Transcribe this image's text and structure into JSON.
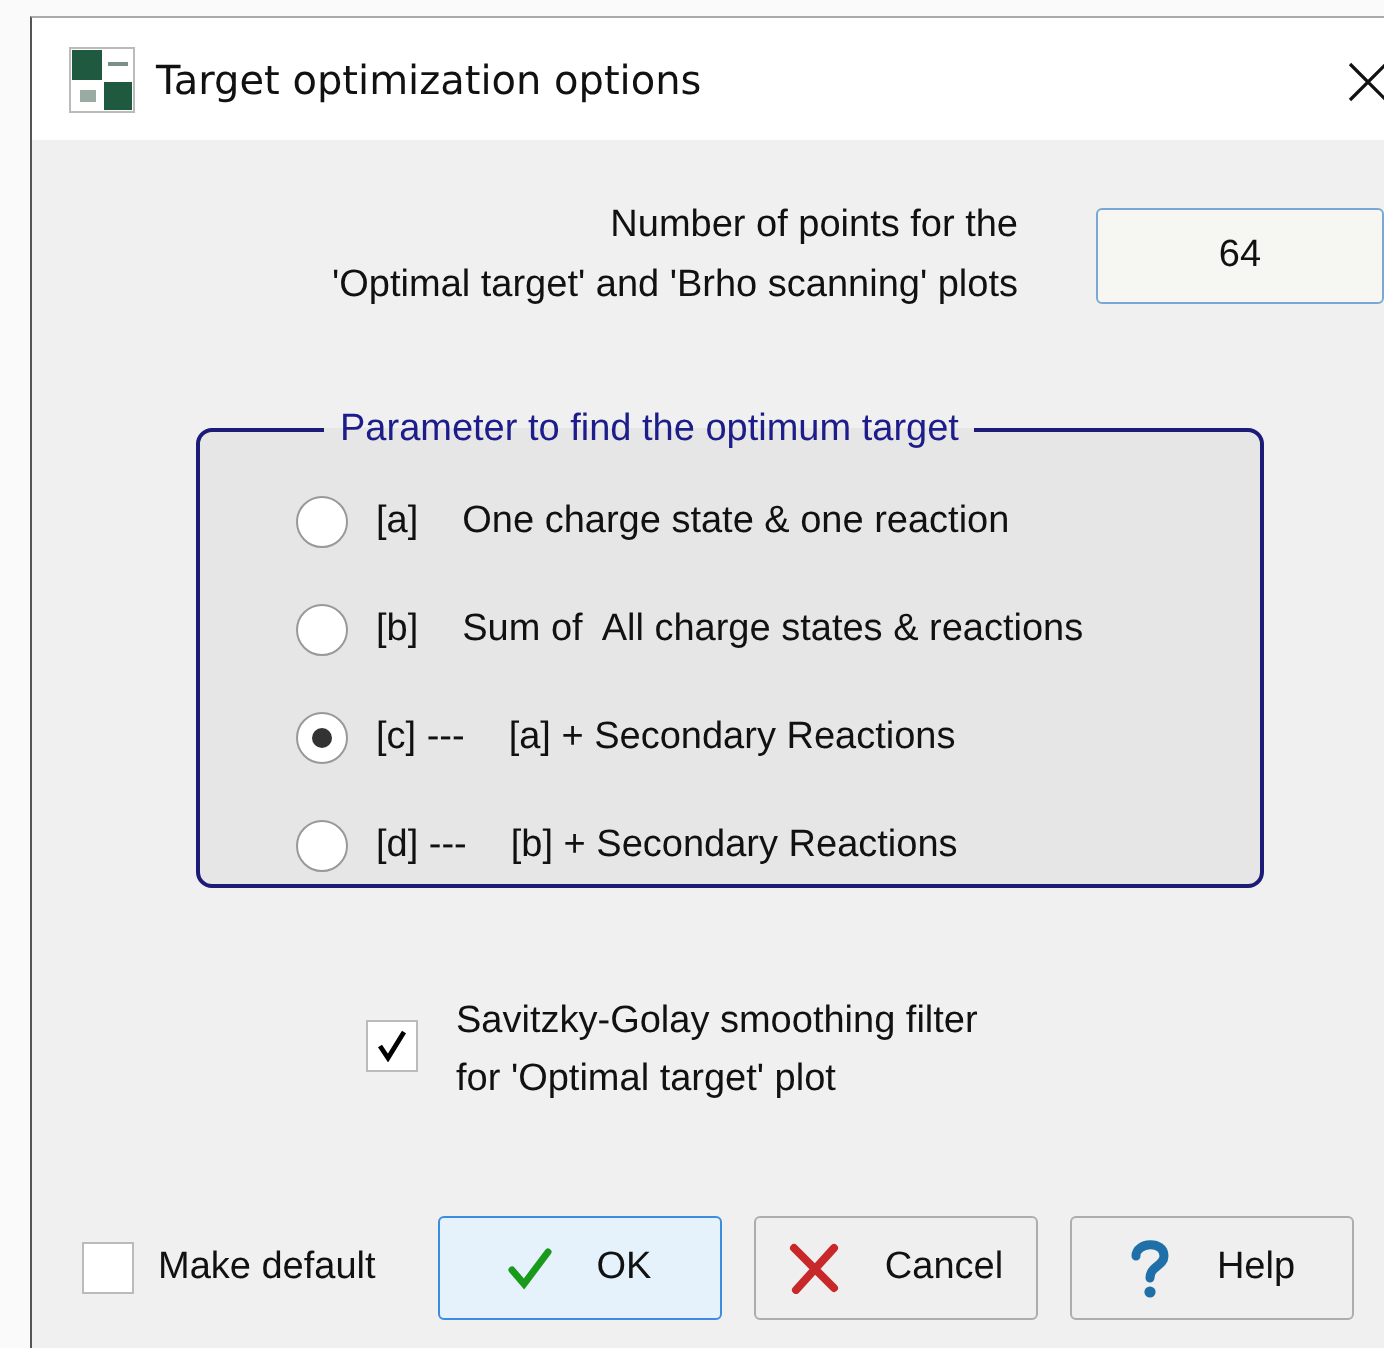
{
  "window": {
    "title": "Target optimization options"
  },
  "points": {
    "label_lines": [
      "Number of points for the",
      "'Optimal target' and 'Brho scanning' plots"
    ],
    "value": "64"
  },
  "parameter_group": {
    "title": "Parameter to find the optimum target",
    "options": [
      {
        "tag": "[a]",
        "text": "One charge state & one reaction",
        "selected": false
      },
      {
        "tag": "[b]",
        "text": "Sum of  All charge states & reactions",
        "selected": false
      },
      {
        "tag": "[c] ---",
        "text": "[a] + Secondary Reactions",
        "selected": true
      },
      {
        "tag": "[d] ---",
        "text": "[b] + Secondary Reactions",
        "selected": false
      }
    ]
  },
  "smoothing": {
    "label_lines": [
      "Savitzky-Golay smoothing filter",
      "for 'Optimal target' plot"
    ],
    "checked": true
  },
  "make_default": {
    "label": "Make default",
    "checked": false
  },
  "buttons": [
    {
      "kind": "ok",
      "label": "OK",
      "focused": true
    },
    {
      "kind": "cancel",
      "label": "Cancel",
      "focused": false
    },
    {
      "kind": "help",
      "label": "Help",
      "focused": false
    }
  ]
}
